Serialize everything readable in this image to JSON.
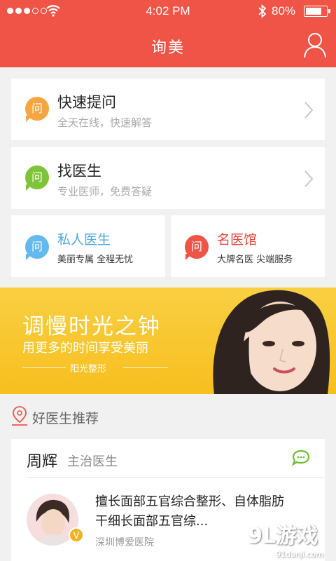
{
  "status_bar": {
    "time": "4:02 PM",
    "battery": "80%",
    "battery_level": 0.8,
    "signal_bars_filled": 3,
    "signal_bars_total": 5
  },
  "header": {
    "title": "询美",
    "user_icon": "user-icon"
  },
  "menu": {
    "quick_ask": {
      "badge": "问",
      "title": "快速提问",
      "subtitle": "全天在线，快速解答"
    },
    "find_doctor": {
      "badge": "问",
      "title": "找医生",
      "subtitle": "专业医师，免费答疑"
    },
    "private_doctor": {
      "badge": "问",
      "title": "私人医生",
      "subtitle": "美丽专属  全程无忧"
    },
    "famous_clinic": {
      "badge": "问",
      "title": "名医馆",
      "subtitle": "大牌名医  尖端服务"
    }
  },
  "banner": {
    "headline": "调慢时光之钟",
    "subline": "用更多的时间享受美丽",
    "tag": "阳光整形"
  },
  "recommend": {
    "section_title": "好医生推荐",
    "doctor": {
      "name": "周辉",
      "role": "主治医生",
      "description": "擅长面部五官综合整形、自体脂肪干细长面部五官综...",
      "hospital": "深圳博爱医院",
      "verified_mark": "V"
    }
  },
  "watermark": {
    "brand": "9L游戏",
    "url": "91danji.com"
  },
  "colors": {
    "primary": "#ef5446",
    "orange": "#f6a640",
    "green": "#7fc438",
    "blue": "#63b9ee",
    "banner": "#f7bf1e",
    "chat_green": "#6dbf2e"
  }
}
